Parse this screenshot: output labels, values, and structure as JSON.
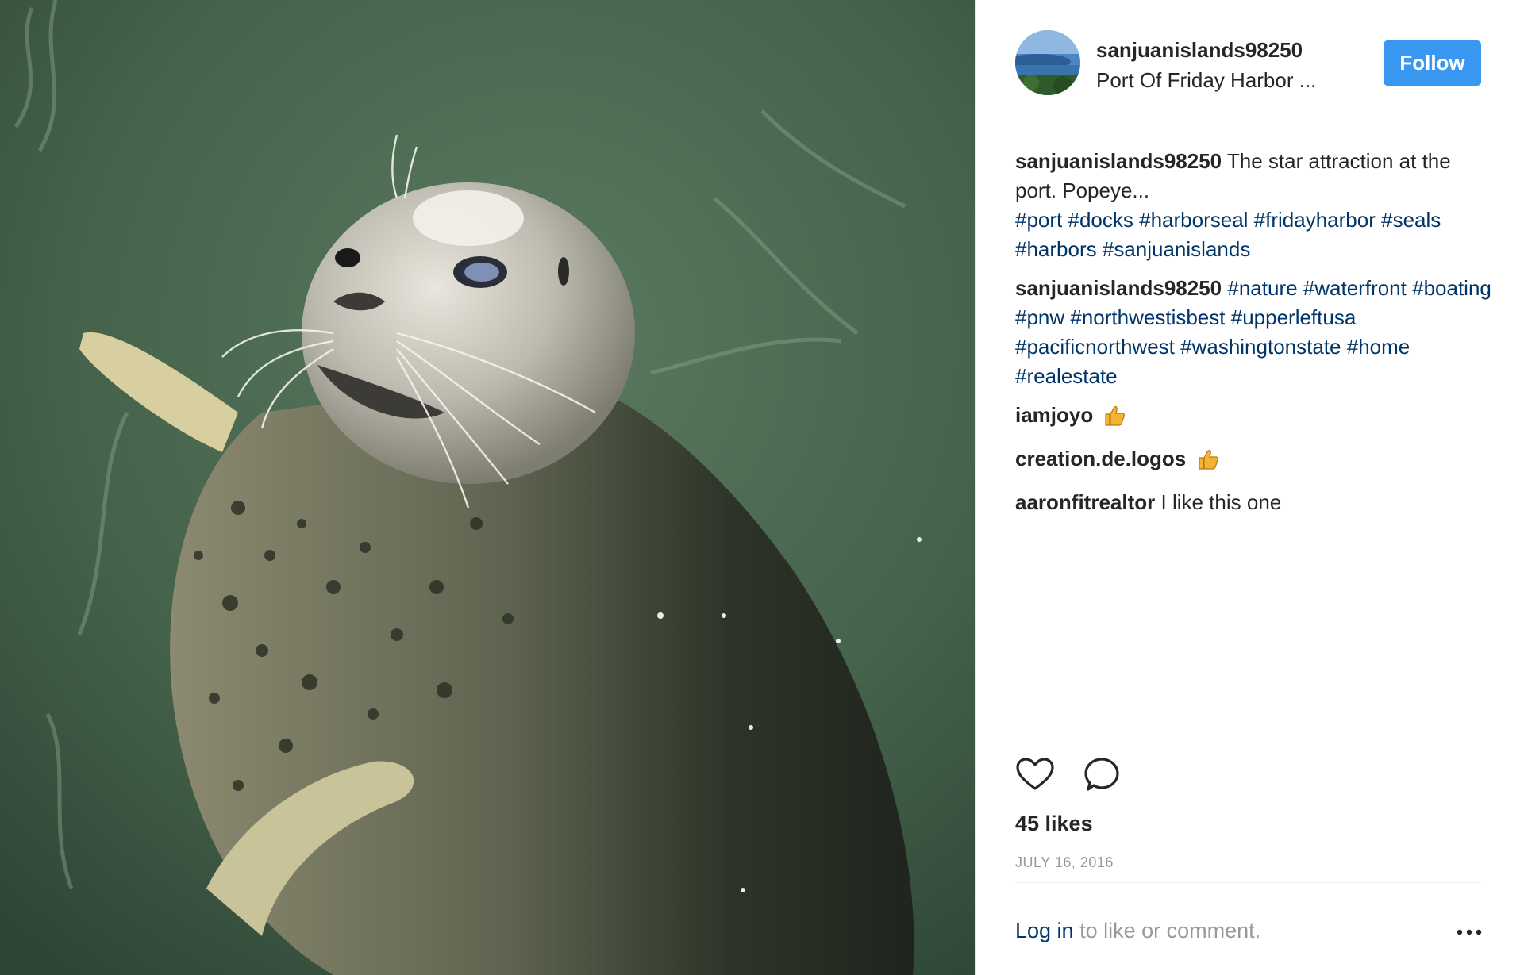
{
  "photo": {
    "alt": ""
  },
  "owner": {
    "username": "sanjuanislands98250",
    "location": "Port Of Friday Harbor ..."
  },
  "follow_label": "Follow",
  "comments": [
    {
      "user": "sanjuanislands98250",
      "text": "The star attraction at the port. Popeye...",
      "tags": [
        "#port",
        "#docks",
        "#harborseal",
        "#fridayharbor",
        "#seals",
        "#harbors",
        "#sanjuanislands"
      ]
    },
    {
      "user": "sanjuanislands98250",
      "tags": [
        "#nature",
        "#waterfront",
        "#boating",
        "#pnw",
        "#northwestisbest",
        "#upperleftusa",
        "#pacificnorthwest",
        "#washingtonstate",
        "#home",
        "#realestate"
      ]
    },
    {
      "user": "iamjoyo",
      "emoji": "thumbs-up-icon"
    },
    {
      "user": "creation.de.logos",
      "emoji": "thumbs-up-icon"
    },
    {
      "user": "aaronfitrealtor",
      "text": "I like this one"
    }
  ],
  "likes": "45 likes",
  "date": "JULY 16, 2016",
  "login": {
    "link": "Log in",
    "rest": " to like or comment."
  },
  "colors": {
    "accent": "#3897f0",
    "hashtag": "#003569",
    "muted": "#999999",
    "text": "#262626"
  }
}
